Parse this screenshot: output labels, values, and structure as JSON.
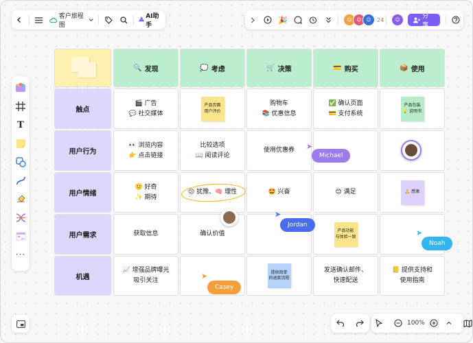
{
  "toolbar": {
    "doc_title": "客户旅程图",
    "ai_label": "AI助手",
    "collab_count": "24",
    "share_label": "分享"
  },
  "zoom": {
    "value": "100%"
  },
  "table": {
    "headers": [
      {
        "icon": "🔍",
        "label": "发现"
      },
      {
        "icon": "💭",
        "label": "考虑"
      },
      {
        "icon": "🛒",
        "label": "决策"
      },
      {
        "icon": "💳",
        "label": "购买"
      },
      {
        "icon": "📦",
        "label": "使用"
      }
    ],
    "rows": [
      {
        "label": "触点",
        "cells": [
          {
            "lines": [
              "🎬 广告",
              "💬 社交媒体"
            ]
          },
          {
            "note": [
              "产品页面",
              "用户评价"
            ],
            "note_color": "#fbe58a"
          },
          {
            "lines": [
              "购物车",
              "📚 优惠信息"
            ]
          },
          {
            "lines": [
              "✅ 确认页面",
              "💳 支付系统"
            ]
          },
          {
            "note": [
              "产品包装",
              "💡 说明书"
            ],
            "note_color": "#b7ecc8"
          }
        ]
      },
      {
        "label": "用户行为",
        "cells": [
          {
            "lines": [
              "👀 浏览内容",
              "👉 点击链接"
            ]
          },
          {
            "lines": [
              "比较选项",
              "📖 阅读评论"
            ]
          },
          {
            "lines": [
              "使用优惠券"
            ]
          },
          {
            "lines": []
          },
          {
            "lines": []
          }
        ]
      },
      {
        "label": "用户情绪",
        "cells": [
          {
            "lines": [
              "🙂 好奇",
              "✨ 期待"
            ]
          },
          {
            "lines": [
              "😕 犹豫、🧠 理性"
            ],
            "circled": true
          },
          {
            "lines": [
              "🤩 兴奋"
            ]
          },
          {
            "lines": [
              "😊 满足"
            ]
          },
          {
            "note": [
              "🙏 感激"
            ],
            "note_color": "#dcd2fb"
          }
        ]
      },
      {
        "label": "用户需求",
        "cells": [
          {
            "lines": [
              "获取信息"
            ]
          },
          {
            "lines": [
              "确认价值"
            ]
          },
          {
            "lines": []
          },
          {
            "note": [
              "产品功能",
              "与体验一致"
            ],
            "note_color": "#fbe58a"
          },
          {
            "lines": []
          }
        ]
      },
      {
        "label": "机遇",
        "cells": [
          {
            "lines": [
              "📈 增强品牌曝光",
              "吸引关注"
            ]
          },
          {
            "lines": []
          },
          {
            "note": [
              "提供简单",
              "的退款流程"
            ],
            "note_color": "#b5d3fb"
          },
          {
            "lines": [
              "发送确认邮件、",
              "快速配送"
            ]
          },
          {
            "lines": [
              "📒 提供支持和",
              "使用指南"
            ]
          }
        ]
      }
    ]
  },
  "collaborators": [
    {
      "name": "Michael",
      "color": "#9b7bf0"
    },
    {
      "name": "Jordan",
      "color": "#4a6cf0"
    },
    {
      "name": "Noah",
      "color": "#35b5f0"
    },
    {
      "name": "Casey",
      "color": "#f59e3b"
    }
  ]
}
